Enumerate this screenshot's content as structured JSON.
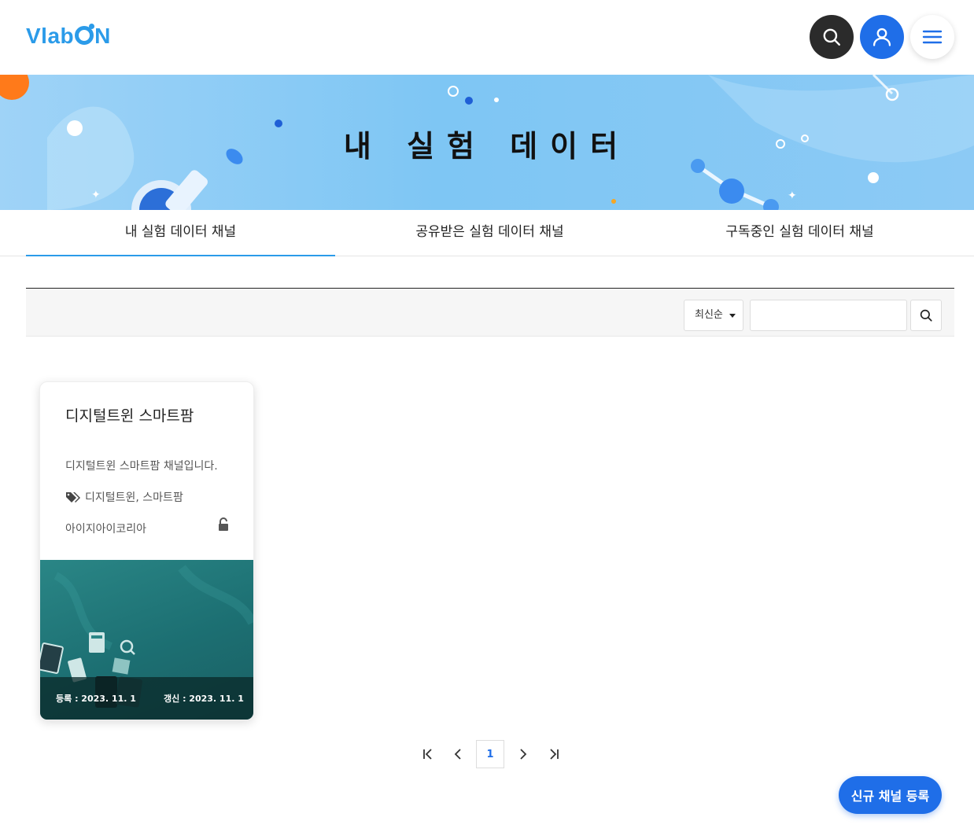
{
  "header": {
    "logo_text_a": "Vlab",
    "logo_text_b": "N",
    "search_icon": "search-icon",
    "user_icon": "user-icon",
    "menu_icon": "hamburger-icon"
  },
  "banner": {
    "title": "내 실험 데이터"
  },
  "tabs": [
    {
      "label": "내 실험 데이터 채널",
      "active": true
    },
    {
      "label": "공유받은 실험 데이터 채널",
      "active": false
    },
    {
      "label": "구독중인 실험 데이터 채널",
      "active": false
    }
  ],
  "filter": {
    "sort_label": "최신순",
    "search_placeholder": "",
    "search_value": ""
  },
  "cards": [
    {
      "title": "디지털트윈 스마트팜",
      "description": "디지털트윈 스마트팜 채널입니다.",
      "tags": "디지털트윈, 스마트팜",
      "owner": "아이지아이코리아",
      "registered": "등록 : 2023. 11. 1",
      "updated": "갱신 : 2023. 11. 1"
    }
  ],
  "pagination": {
    "current_page": "1"
  },
  "actions": {
    "new_channel": "신규 채널 등록"
  },
  "colors": {
    "accent": "#1f6ee8",
    "logo": "#2b9be9",
    "dark_button": "#2b2b2b"
  }
}
